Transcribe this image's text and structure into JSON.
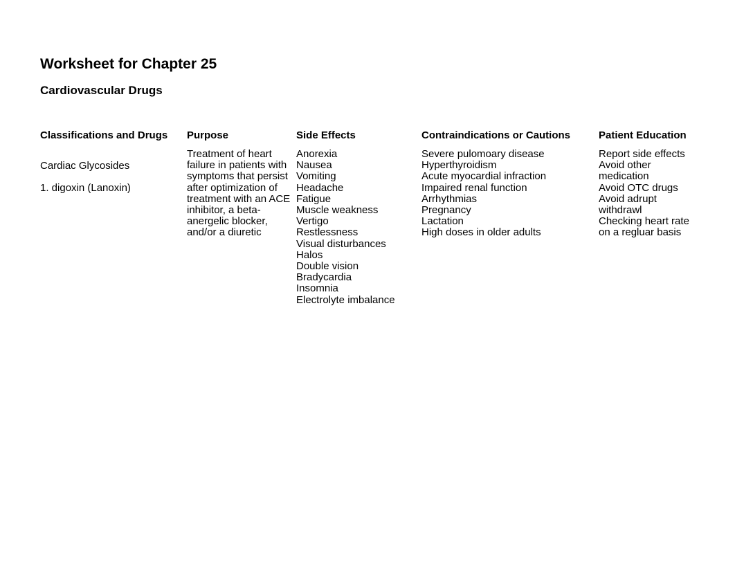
{
  "document": {
    "title": "Worksheet for Chapter 25",
    "subtitle": "Cardiovascular Drugs"
  },
  "table": {
    "headers": {
      "classifications": "Classifications and Drugs",
      "purpose": "Purpose",
      "side_effects": "Side Effects",
      "contraindications": "Contraindications or Cautions",
      "patient_education": "Patient Education"
    },
    "rows": [
      {
        "category": "Cardiac Glycosides",
        "drug": "1. digoxin (Lanoxin)",
        "purpose": "Treatment of heart failure in patients with symptoms that persist after optimization of treatment with an ACE inhibitor, a beta-anergelic blocker, and/or a diuretic",
        "side_effects": [
          "Anorexia",
          "Nausea",
          "Vomiting",
          "Headache",
          "Fatigue",
          "Muscle weakness",
          "Vertigo",
          "Restlessness",
          "Visual disturbances",
          "Halos",
          "Double vision",
          "Bradycardia",
          "Insomnia",
          "Electrolyte imbalance"
        ],
        "contraindications": [
          "Severe pulomoary disease",
          "Hyperthyroidism",
          "Acute myocardial infraction",
          "Impaired renal function",
          "Arrhythmias",
          "Pregnancy",
          "Lactation",
          "High doses in older adults"
        ],
        "patient_education": [
          "Report side effects",
          "Avoid other medication",
          "Avoid OTC drugs",
          "Avoid adrupt withdrawl",
          "Checking heart rate on a regluar basis"
        ]
      }
    ]
  }
}
